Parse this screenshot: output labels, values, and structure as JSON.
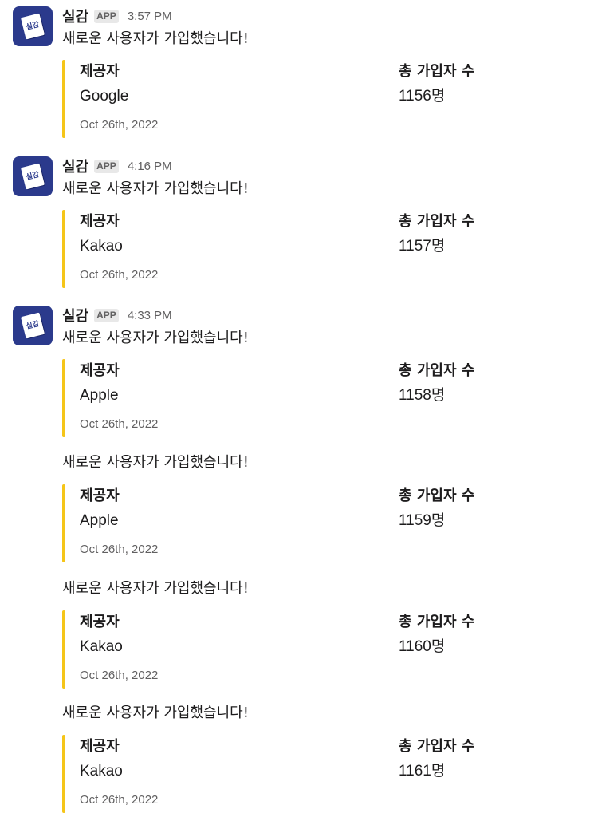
{
  "app": {
    "name": "실감",
    "badge": "APP",
    "avatar_text": "실감",
    "accent_color": "#f5c518",
    "avatar_color": "#2b3a8c"
  },
  "messages": [
    {
      "time": "3:57 PM",
      "text": "새로운 사용자가 가입했습니다!",
      "fields": [
        {
          "title": "제공자",
          "value": "Google"
        },
        {
          "title": "총 가입자 수",
          "value": "1156명"
        }
      ],
      "footer": "Oct 26th, 2022"
    },
    {
      "time": "4:16 PM",
      "text": "새로운 사용자가 가입했습니다!",
      "fields": [
        {
          "title": "제공자",
          "value": "Kakao"
        },
        {
          "title": "총 가입자 수",
          "value": "1157명"
        }
      ],
      "footer": "Oct 26th, 2022"
    },
    {
      "time": "4:33 PM",
      "text": "새로운 사용자가 가입했습니다!",
      "fields": [
        {
          "title": "제공자",
          "value": "Apple"
        },
        {
          "title": "총 가입자 수",
          "value": "1158명"
        }
      ],
      "footer": "Oct 26th, 2022"
    },
    {
      "text": "새로운 사용자가 가입했습니다!",
      "fields": [
        {
          "title": "제공자",
          "value": "Apple"
        },
        {
          "title": "총 가입자 수",
          "value": "1159명"
        }
      ],
      "footer": "Oct 26th, 2022"
    },
    {
      "text": "새로운 사용자가 가입했습니다!",
      "fields": [
        {
          "title": "제공자",
          "value": "Kakao"
        },
        {
          "title": "총 가입자 수",
          "value": "1160명"
        }
      ],
      "footer": "Oct 26th, 2022"
    },
    {
      "text": "새로운 사용자가 가입했습니다!",
      "fields": [
        {
          "title": "제공자",
          "value": "Kakao"
        },
        {
          "title": "총 가입자 수",
          "value": "1161명"
        }
      ],
      "footer": "Oct 26th, 2022"
    }
  ]
}
